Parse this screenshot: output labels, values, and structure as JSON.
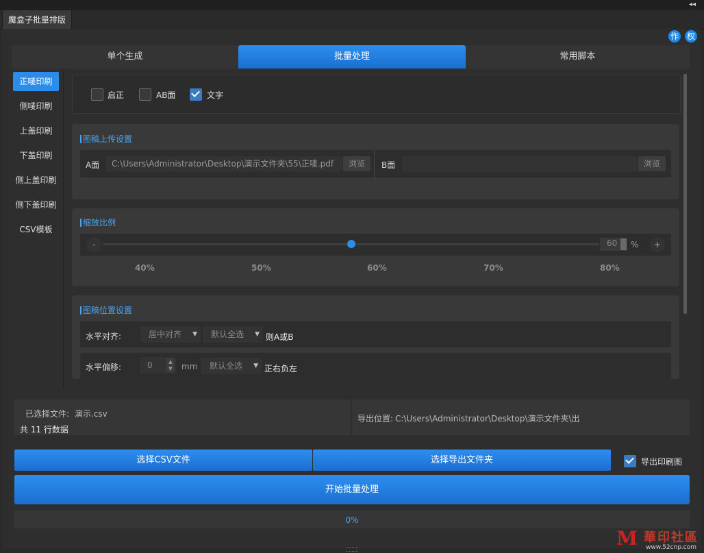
{
  "window": {
    "collapse_glyph": "◂◂",
    "app_tab": "魔盒子批量排版"
  },
  "header_icons": {
    "author": "作",
    "copyright": "权"
  },
  "tabs": [
    {
      "label": "单个生成",
      "active": false
    },
    {
      "label": "批量处理",
      "active": true
    },
    {
      "label": "常用脚本",
      "active": false
    }
  ],
  "sidebar": {
    "items": [
      {
        "label": "正唛印刷",
        "active": true
      },
      {
        "label": "侧唛印刷",
        "active": false
      },
      {
        "label": "上盖印刷",
        "active": false
      },
      {
        "label": "下盖印刷",
        "active": false
      },
      {
        "label": "侧上盖印刷",
        "active": false
      },
      {
        "label": "侧下盖印刷",
        "active": false
      },
      {
        "label": "CSV模板",
        "active": false
      }
    ]
  },
  "options": {
    "qizheng": {
      "label": "启正",
      "checked": false
    },
    "ab_face": {
      "label": "AB面",
      "checked": false
    },
    "text": {
      "label": "文字",
      "checked": true
    }
  },
  "upload": {
    "title": "图稿上传设置",
    "a_label": "A面",
    "a_value": "C:\\Users\\Administrator\\Desktop\\演示文件夹\\55\\正唛.pdf",
    "a_browse": "浏览",
    "b_label": "B面",
    "b_value": "",
    "b_browse": "浏览"
  },
  "scale": {
    "title": "缩放比例",
    "minus": "-",
    "plus": "+",
    "value": "60",
    "value_numeric": 60,
    "min": 35,
    "max": 85,
    "unit": "%",
    "ticks": [
      "40%",
      "50%",
      "60%",
      "70%",
      "80%"
    ]
  },
  "position": {
    "title": "图稿位置设置",
    "h_align_label": "水平对齐:",
    "h_align_value": "居中对齐",
    "h_align_scope": "默认全选",
    "h_align_note": "则A或B",
    "h_offset_label": "水平偏移:",
    "h_offset_value": "0",
    "h_offset_unit": "mm",
    "h_offset_scope": "默认全选",
    "h_offset_note": "正右负左"
  },
  "status": {
    "selected_file_label": "已选择文件:",
    "selected_file": "演示.csv",
    "row_count": "共 11 行数据",
    "export_location_label": "导出位置:",
    "export_location": "C:\\Users\\Administrator\\Desktop\\演示文件夹\\出"
  },
  "actions": {
    "choose_csv": "选择CSV文件",
    "choose_export": "选择导出文件夹",
    "export_print_label": "导出印刷图",
    "export_print_checked": true,
    "start": "开始批量处理"
  },
  "progress": {
    "text": "0%",
    "fraction": 0
  },
  "watermark": {
    "cn": "華印社區",
    "url": "www.52cnp.com"
  },
  "colors": {
    "accent": "#2b8de8",
    "background": "#2a2a2a",
    "card": "#393939",
    "title_blue": "#4aa3f0"
  }
}
